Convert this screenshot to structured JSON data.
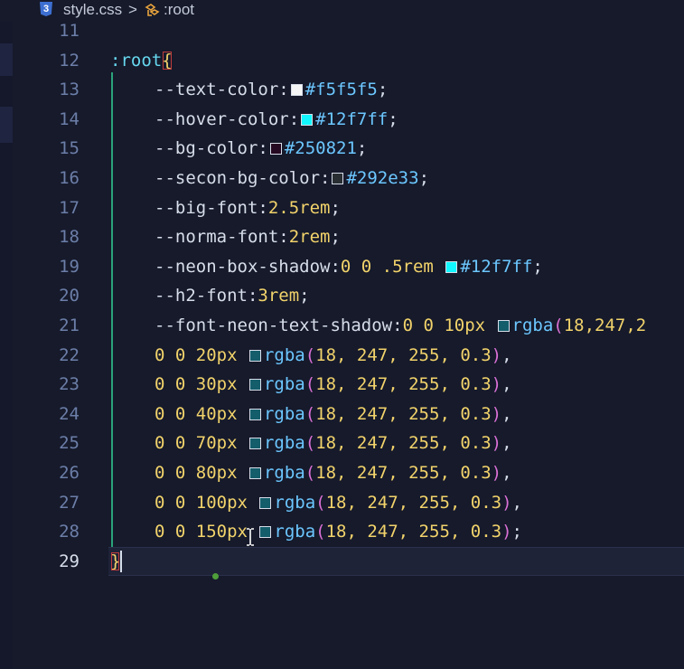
{
  "breadcrumb": {
    "file_icon": "css3-icon",
    "file_icon_glyph": "3",
    "file": "style.css",
    "separator": ">",
    "symbol_icon": "symbol-class-icon",
    "symbol": ":root"
  },
  "editor": {
    "active_line": 29,
    "lines": [
      {
        "n": "11",
        "tokens": []
      },
      {
        "n": "12",
        "tokens": [
          {
            "t": ":root",
            "c": "t-sel"
          },
          {
            "t": "{",
            "c": "brace-open"
          }
        ]
      },
      {
        "n": "13",
        "tokens": [
          {
            "t": "--text-color",
            "c": "t-prop"
          },
          {
            "t": ":",
            "c": "t-punc"
          },
          {
            "swatch": "#f5f5f5"
          },
          {
            "t": "#f5f5f5",
            "c": "t-hex"
          },
          {
            "t": ";",
            "c": "t-punc"
          }
        ]
      },
      {
        "n": "14",
        "tokens": [
          {
            "t": "--hover-color",
            "c": "t-prop"
          },
          {
            "t": ":",
            "c": "t-punc"
          },
          {
            "swatch": "#12f7ff"
          },
          {
            "t": "#12f7ff",
            "c": "t-hex"
          },
          {
            "t": ";",
            "c": "t-punc"
          }
        ]
      },
      {
        "n": "15",
        "tokens": [
          {
            "t": "--bg-color",
            "c": "t-prop"
          },
          {
            "t": ":",
            "c": "t-punc"
          },
          {
            "swatch": "#250821"
          },
          {
            "t": "#250821",
            "c": "t-hex"
          },
          {
            "t": ";",
            "c": "t-punc"
          }
        ]
      },
      {
        "n": "16",
        "tokens": [
          {
            "t": "--secon-bg-color",
            "c": "t-prop"
          },
          {
            "t": ":",
            "c": "t-punc"
          },
          {
            "swatch": "#292e33"
          },
          {
            "t": "#292e33",
            "c": "t-hex"
          },
          {
            "t": ";",
            "c": "t-punc"
          }
        ]
      },
      {
        "n": "17",
        "tokens": [
          {
            "t": "--big-font",
            "c": "t-prop"
          },
          {
            "t": ":",
            "c": "t-punc"
          },
          {
            "t": "2.5rem",
            "c": "t-val"
          },
          {
            "t": ";",
            "c": "t-punc"
          }
        ]
      },
      {
        "n": "18",
        "tokens": [
          {
            "t": "--norma-font",
            "c": "t-prop"
          },
          {
            "t": ":",
            "c": "t-punc"
          },
          {
            "t": "2rem",
            "c": "t-val"
          },
          {
            "t": ";",
            "c": "t-punc"
          }
        ]
      },
      {
        "n": "19",
        "tokens": [
          {
            "t": "--neon-box-shadow",
            "c": "t-prop"
          },
          {
            "t": ":",
            "c": "t-punc"
          },
          {
            "t": "0 0 .5rem ",
            "c": "t-val"
          },
          {
            "swatch": "#12f7ff"
          },
          {
            "t": "#12f7ff",
            "c": "t-hex"
          },
          {
            "t": ";",
            "c": "t-punc"
          }
        ]
      },
      {
        "n": "20",
        "tokens": [
          {
            "t": "--h2-font",
            "c": "t-prop"
          },
          {
            "t": ":",
            "c": "t-punc"
          },
          {
            "t": "3rem",
            "c": "t-val"
          },
          {
            "t": ";",
            "c": "t-punc"
          }
        ]
      },
      {
        "n": "21",
        "tokens": [
          {
            "t": "--font-neon-text-shadow",
            "c": "t-prop"
          },
          {
            "t": ":",
            "c": "t-punc"
          },
          {
            "t": "0 0 10px ",
            "c": "t-val"
          },
          {
            "swatch": "#12f7ff4d"
          },
          {
            "t": "rgba",
            "c": "t-fn"
          },
          {
            "t": "(",
            "c": "t-paren"
          },
          {
            "t": "18,247,2",
            "c": "t-val"
          }
        ]
      },
      {
        "n": "22",
        "tokens": [
          {
            "t": "0 0 20px ",
            "c": "t-val"
          },
          {
            "swatch": "#12f7ff4d"
          },
          {
            "t": "rgba",
            "c": "t-fn"
          },
          {
            "t": "(",
            "c": "t-paren"
          },
          {
            "t": "18, 247, 255, 0.3",
            "c": "t-val"
          },
          {
            "t": ")",
            "c": "t-paren"
          },
          {
            "t": ",",
            "c": "t-punc"
          }
        ]
      },
      {
        "n": "23",
        "tokens": [
          {
            "t": "0 0 30px ",
            "c": "t-val"
          },
          {
            "swatch": "#12f7ff4d"
          },
          {
            "t": "rgba",
            "c": "t-fn"
          },
          {
            "t": "(",
            "c": "t-paren"
          },
          {
            "t": "18, 247, 255, 0.3",
            "c": "t-val"
          },
          {
            "t": ")",
            "c": "t-paren"
          },
          {
            "t": ",",
            "c": "t-punc"
          }
        ]
      },
      {
        "n": "24",
        "tokens": [
          {
            "t": "0 0 40px ",
            "c": "t-val"
          },
          {
            "swatch": "#12f7ff4d"
          },
          {
            "t": "rgba",
            "c": "t-fn"
          },
          {
            "t": "(",
            "c": "t-paren"
          },
          {
            "t": "18, 247, 255, 0.3",
            "c": "t-val"
          },
          {
            "t": ")",
            "c": "t-paren"
          },
          {
            "t": ",",
            "c": "t-punc"
          }
        ]
      },
      {
        "n": "25",
        "tokens": [
          {
            "t": "0 0 70px ",
            "c": "t-val"
          },
          {
            "swatch": "#12f7ff4d"
          },
          {
            "t": "rgba",
            "c": "t-fn"
          },
          {
            "t": "(",
            "c": "t-paren"
          },
          {
            "t": "18, 247, 255, 0.3",
            "c": "t-val"
          },
          {
            "t": ")",
            "c": "t-paren"
          },
          {
            "t": ",",
            "c": "t-punc"
          }
        ]
      },
      {
        "n": "26",
        "tokens": [
          {
            "t": "0 0 80px ",
            "c": "t-val"
          },
          {
            "swatch": "#12f7ff4d"
          },
          {
            "t": "rgba",
            "c": "t-fn"
          },
          {
            "t": "(",
            "c": "t-paren"
          },
          {
            "t": "18, 247, 255, 0.3",
            "c": "t-val"
          },
          {
            "t": ")",
            "c": "t-paren"
          },
          {
            "t": ",",
            "c": "t-punc"
          }
        ]
      },
      {
        "n": "27",
        "tokens": [
          {
            "t": "0 0 100px ",
            "c": "t-val"
          },
          {
            "swatch": "#12f7ff4d"
          },
          {
            "t": "rgba",
            "c": "t-fn"
          },
          {
            "t": "(",
            "c": "t-paren"
          },
          {
            "t": "18, 247, 255, 0.3",
            "c": "t-val"
          },
          {
            "t": ")",
            "c": "t-paren"
          },
          {
            "t": ",",
            "c": "t-punc"
          }
        ]
      },
      {
        "n": "28",
        "tokens": [
          {
            "t": "0 0 150px ",
            "c": "t-val"
          },
          {
            "swatch": "#12f7ff4d"
          },
          {
            "t": "rgba",
            "c": "t-fn"
          },
          {
            "t": "(",
            "c": "t-paren"
          },
          {
            "t": "18, 247, 255, 0.3",
            "c": "t-val"
          },
          {
            "t": ")",
            "c": "t-paren"
          },
          {
            "t": ";",
            "c": "t-punc"
          }
        ]
      },
      {
        "n": "29",
        "tokens": [
          {
            "t": "}",
            "c": "brace-close"
          }
        ]
      }
    ]
  },
  "colors": {
    "background": "#161a2b",
    "line_number": "#6c7ea8",
    "property": "#d7dde9",
    "value": "#f2d36b",
    "hex": "#6cc7ff",
    "paren": "#da70d6",
    "indent_guide": "#2ba37a"
  }
}
